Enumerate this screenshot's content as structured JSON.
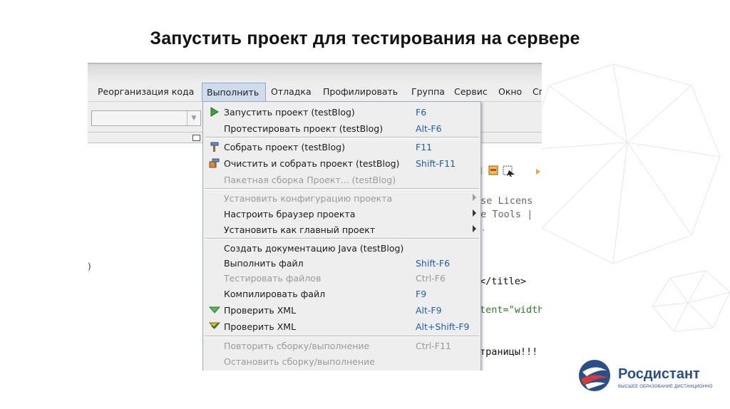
{
  "slide": {
    "title": "Запустить проект для тестирования на сервере"
  },
  "menubar": {
    "items": [
      "Реорганизация кода",
      "Выполнить",
      "Отладка",
      "Профилировать",
      "Группа",
      "Сервис",
      "Окно",
      "Сп"
    ],
    "active": "Выполнить"
  },
  "editor": {
    "lines": [
      "ose Licens",
      "se Tools |",
      "r.",
      "</title>",
      "tent=\"width",
      "траницы!!!"
    ]
  },
  "run_menu": {
    "items": [
      {
        "label": "Запустить проект (testBlog)",
        "shortcut": "F6",
        "enabled": true,
        "icon": "run-icon"
      },
      {
        "label": "Протестировать проект (testBlog)",
        "shortcut": "Alt-F6",
        "enabled": true
      },
      {
        "label": "Собрать проект (testBlog)",
        "shortcut": "F11",
        "enabled": true,
        "icon": "hammer-icon"
      },
      {
        "label": "Очистить и собрать проект (testBlog)",
        "shortcut": "Shift-F11",
        "enabled": true,
        "icon": "clean-build-icon"
      },
      {
        "label": "Пакетная сборка Проект... (testBlog)",
        "shortcut": "",
        "enabled": false
      },
      {
        "label": "Установить конфигурацию проекта",
        "shortcut": "",
        "enabled": false,
        "submenu": true
      },
      {
        "label": "Настроить браузер проекта",
        "shortcut": "",
        "enabled": true,
        "submenu": true
      },
      {
        "label": "Установить как главный проект",
        "shortcut": "",
        "enabled": true,
        "submenu": true
      },
      {
        "label": "Создать документацию Java  (testBlog)",
        "shortcut": "",
        "enabled": true
      },
      {
        "label": "Выполнить файл",
        "shortcut": "Shift-F6",
        "enabled": true
      },
      {
        "label": "Тестировать файлов",
        "shortcut": "Ctrl-F6",
        "enabled": false
      },
      {
        "label": "Компилировать файл",
        "shortcut": "F9",
        "enabled": true
      },
      {
        "label": "Проверить XML",
        "shortcut": "Alt-F9",
        "enabled": true,
        "icon": "check-xml-icon"
      },
      {
        "label": "Проверить XML",
        "shortcut": "Alt+Shift-F9",
        "enabled": true,
        "icon": "validate-xml-icon"
      },
      {
        "label": "Повторить сборку/выполнение",
        "shortcut": "Ctrl-F11",
        "enabled": false
      },
      {
        "label": "Остановить сборку/выполнение",
        "shortcut": "",
        "enabled": false
      }
    ]
  },
  "logo": {
    "name": "Росдистант",
    "tagline": "ВЫСШЕЕ ОБРАЗОВАНИЕ ДИСТАНЦИОННО"
  },
  "colors": {
    "menu_background": "#eeeeee",
    "menu_active": "#cfdcec",
    "shortcut_text": "#1f5ea8",
    "disabled_text": "#9a9a9a",
    "brand_blue": "#2a4f87",
    "brand_red": "#d63a3a"
  }
}
